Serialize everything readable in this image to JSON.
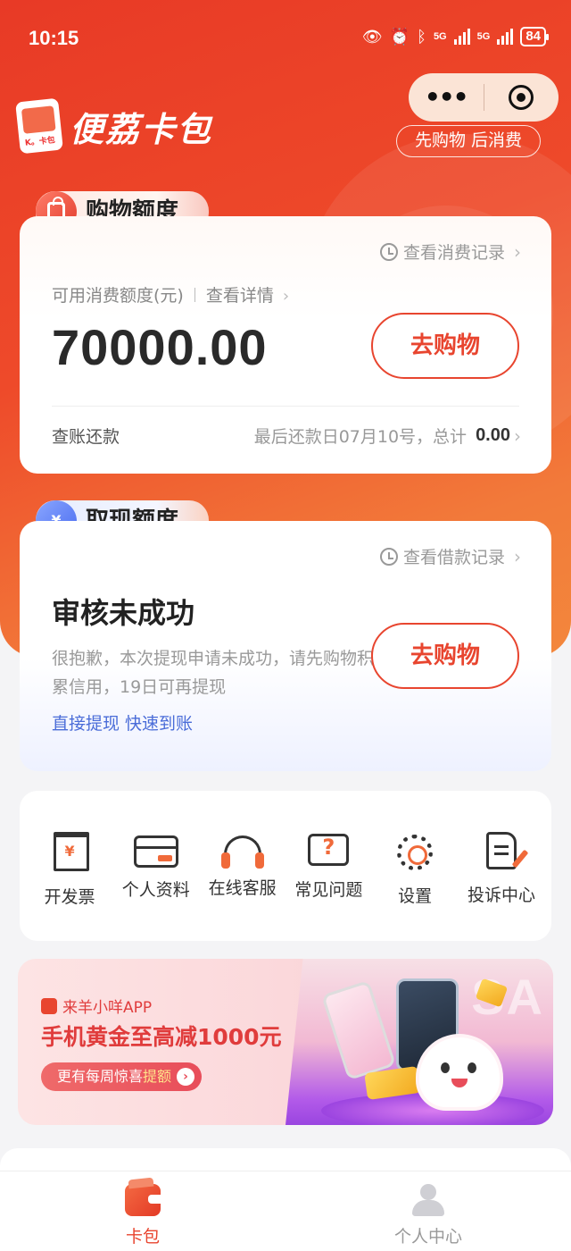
{
  "status_bar": {
    "time": "10:15",
    "network1": "5G",
    "network2": "5G",
    "battery": "84"
  },
  "header": {
    "app_name": "便荔卡包",
    "logo_mark": "K。卡包",
    "capsule_more": "•••",
    "slogan": "先购物 后消费"
  },
  "shopping": {
    "section_title": "购物额度",
    "record_link": "查看消费记录",
    "available_label": "可用消费额度(元)",
    "details_link": "查看详情",
    "amount": "70000.00",
    "shop_button": "去购物",
    "repay_label": "查账还款",
    "repay_info": "最后还款日07月10号，总计",
    "repay_total": "0.00"
  },
  "cash": {
    "section_title": "取现额度",
    "tab_icon": "¥",
    "record_link": "查看借款记录",
    "status_title": "审核未成功",
    "status_desc": "很抱歉，本次提现申请未成功，请先购物积累信用，19日可再提现",
    "quick_link": "直接提现 快速到账",
    "shop_button": "去购物"
  },
  "menu": {
    "items": [
      {
        "label": "开发票",
        "icon": "invoice-icon",
        "glyph": "¥"
      },
      {
        "label": "个人资料",
        "icon": "id-card-icon"
      },
      {
        "label": "在线客服",
        "icon": "headset-icon"
      },
      {
        "label": "常见问题",
        "icon": "faq-icon",
        "glyph": "?"
      },
      {
        "label": "设置",
        "icon": "gear-icon"
      },
      {
        "label": "投诉中心",
        "icon": "complaint-icon"
      }
    ]
  },
  "banner": {
    "app_name": "来羊小咩APP",
    "headline": "手机黄金至高减1000元",
    "pill_text": "更有每周惊喜",
    "pill_highlight": "提额",
    "pill_arrow": "›",
    "watermark": "SA"
  },
  "tabbar": {
    "items": [
      {
        "label": "卡包",
        "icon": "wallet-icon",
        "active": true
      },
      {
        "label": "个人中心",
        "icon": "person-icon",
        "active": false
      }
    ]
  },
  "colors": {
    "brand": "#e8452f",
    "link_blue": "#4a6cd8",
    "accent_orange": "#f06a3a"
  }
}
